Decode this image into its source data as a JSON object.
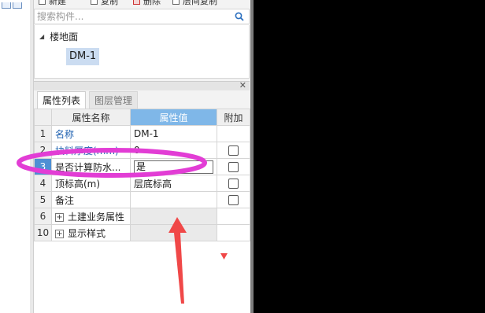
{
  "toolbar": {
    "new_label": "新建",
    "copy_label": "复制",
    "delete_label": "删除",
    "layer_copy_label": "层间复制"
  },
  "search": {
    "placeholder": "搜索构件..."
  },
  "tree": {
    "root_label": "楼地面",
    "child_label": "DM-1"
  },
  "tabs": [
    {
      "label": "属性列表",
      "active": true
    },
    {
      "label": "图层管理",
      "active": false
    }
  ],
  "table": {
    "headers": [
      "属性名称",
      "属性值",
      "附加"
    ],
    "rows": [
      {
        "num": "1",
        "name": "名称",
        "value": "DM-1",
        "checkbox": false
      },
      {
        "num": "2",
        "name": "块料厚度(mm)",
        "value": "0",
        "checkbox": true
      },
      {
        "num": "3",
        "name": "是否计算防水...",
        "value": "是",
        "checkbox": true
      },
      {
        "num": "4",
        "name": "顶标高(m)",
        "value": "层底标高",
        "checkbox": true
      },
      {
        "num": "5",
        "name": "备注",
        "value": "",
        "checkbox": true
      },
      {
        "num": "6",
        "name": "土建业务属性",
        "value": "",
        "checkbox": false,
        "group": true
      },
      {
        "num": "10",
        "name": "显示样式",
        "value": "",
        "checkbox": false,
        "group": true
      }
    ]
  },
  "colors": {
    "header_highlight": "#7fb7e8",
    "selected_row_num": "#4e8fd4",
    "annotation": "#e23dd5",
    "arrow": "#f04848"
  }
}
